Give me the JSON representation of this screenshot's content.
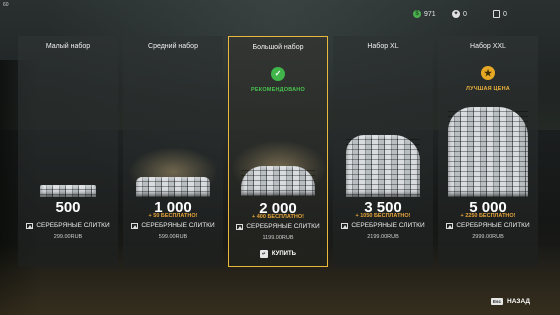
{
  "version": "60",
  "currencies": {
    "credits": {
      "icon": "dollar-icon",
      "value": "971"
    },
    "hunts": {
      "icon": "token-icon",
      "value": "0"
    },
    "cards": {
      "icon": "card-icon",
      "value": "0"
    }
  },
  "packs": [
    {
      "title": "Малый набор",
      "amount": "500",
      "bonus": "",
      "label": "СЕРЕБРЯНЫЕ СЛИТКИ",
      "price": "299.00RUB",
      "badge": ""
    },
    {
      "title": "Средний набор",
      "amount": "1 000",
      "bonus": "+ 50 БЕСПЛАТНО!",
      "label": "СЕРЕБРЯНЫЕ СЛИТКИ",
      "price": "599.00RUB",
      "badge": ""
    },
    {
      "title": "Большой набор",
      "amount": "2 000",
      "bonus": "+ 400 БЕСПЛАТНО!",
      "label": "СЕРЕБРЯНЫЕ СЛИТКИ",
      "price": "1199.00RUB",
      "badge": "РЕКОМЕНДОВАНО"
    },
    {
      "title": "Набор XL",
      "amount": "3 500",
      "bonus": "+ 1050 БЕСПЛАТНО!",
      "label": "СЕРЕБРЯНЫЕ СЛИТКИ",
      "price": "2199.00RUB",
      "badge": ""
    },
    {
      "title": "Набор XXL",
      "amount": "5 000",
      "bonus": "+ 2250 БЕСПЛАТНО!",
      "label": "СЕРЕБРЯНЫЕ СЛИТКИ",
      "price": "2999.00RUB",
      "badge": "ЛУЧШАЯ ЦЕНА"
    }
  ],
  "buy": {
    "key": "↵",
    "label": "КУПИТЬ"
  },
  "back": {
    "key": "Esc",
    "label": "НАЗАД"
  },
  "colors": {
    "selected_border": "#e8b93a",
    "bonus": "#e7a63a",
    "recommended": "#48c34f",
    "best_price": "#eab13a"
  }
}
